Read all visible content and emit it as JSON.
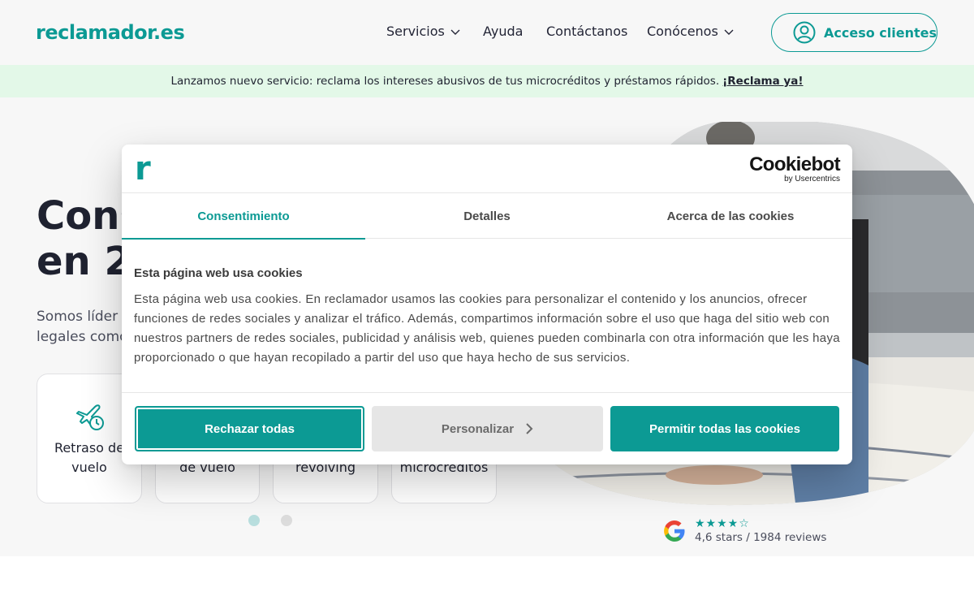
{
  "header": {
    "logo": "reclamador.es",
    "nav": [
      {
        "label": "Servicios",
        "has_dropdown": true
      },
      {
        "label": "Ayuda",
        "has_dropdown": false
      },
      {
        "label": "Contáctanos",
        "has_dropdown": false
      },
      {
        "label": "Conócenos",
        "has_dropdown": true
      }
    ],
    "account_button": "Acceso clientes"
  },
  "banner": {
    "text": "Lanzamos nuevo servicio: reclama los intereses abusivos de tus microcréditos y préstamos rápidos.",
    "link": "¡Reclama ya!"
  },
  "hero": {
    "title_line1": "Cons",
    "title_line2": "en 2",
    "subtitle_line1": "Somos líder",
    "subtitle_line2": "legales como",
    "cards": [
      {
        "label_line1": "Retraso de",
        "label_line2": "vuelo",
        "icon": "plane-clock-icon"
      },
      {
        "label_line1": "",
        "label_line2": "de vuelo"
      },
      {
        "label_line1": "",
        "label_line2": "revolving"
      },
      {
        "label_line1": "",
        "label_line2": "microcréditos"
      }
    ],
    "carousel_dots": 2,
    "carousel_active": 1
  },
  "rating": {
    "stars_text": "★★★★☆",
    "stars_value": 4.6,
    "summary": "4,6 stars / 1984 reviews"
  },
  "cookie_dialog": {
    "brand_mark": "r",
    "provider_name": "Cookiebot",
    "provider_by": "by Usercentrics",
    "tabs": [
      "Consentimiento",
      "Detalles",
      "Acerca de las cookies"
    ],
    "active_tab": "Consentimiento",
    "heading": "Esta página web usa cookies",
    "body": "Esta página web usa cookies. En reclamador usamos las cookies para personalizar el contenido y los anuncios, ofrecer funciones de redes sociales y analizar el tráfico. Además, compartimos información sobre el uso que haga del sitio web con nuestros partners de redes sociales, publicidad y análisis web, quienes pueden combinarla con otra información que les haya proporcionado o que hayan recopilado a partir del uso que haya hecho de sus servicios.",
    "buttons": {
      "reject": "Rechazar todas",
      "customize": "Personalizar",
      "allow": "Permitir todas las cookies"
    }
  },
  "colors": {
    "brand": "#0c9a94",
    "banner_bg": "#e3f8e8",
    "text_dark": "#1f2230"
  }
}
